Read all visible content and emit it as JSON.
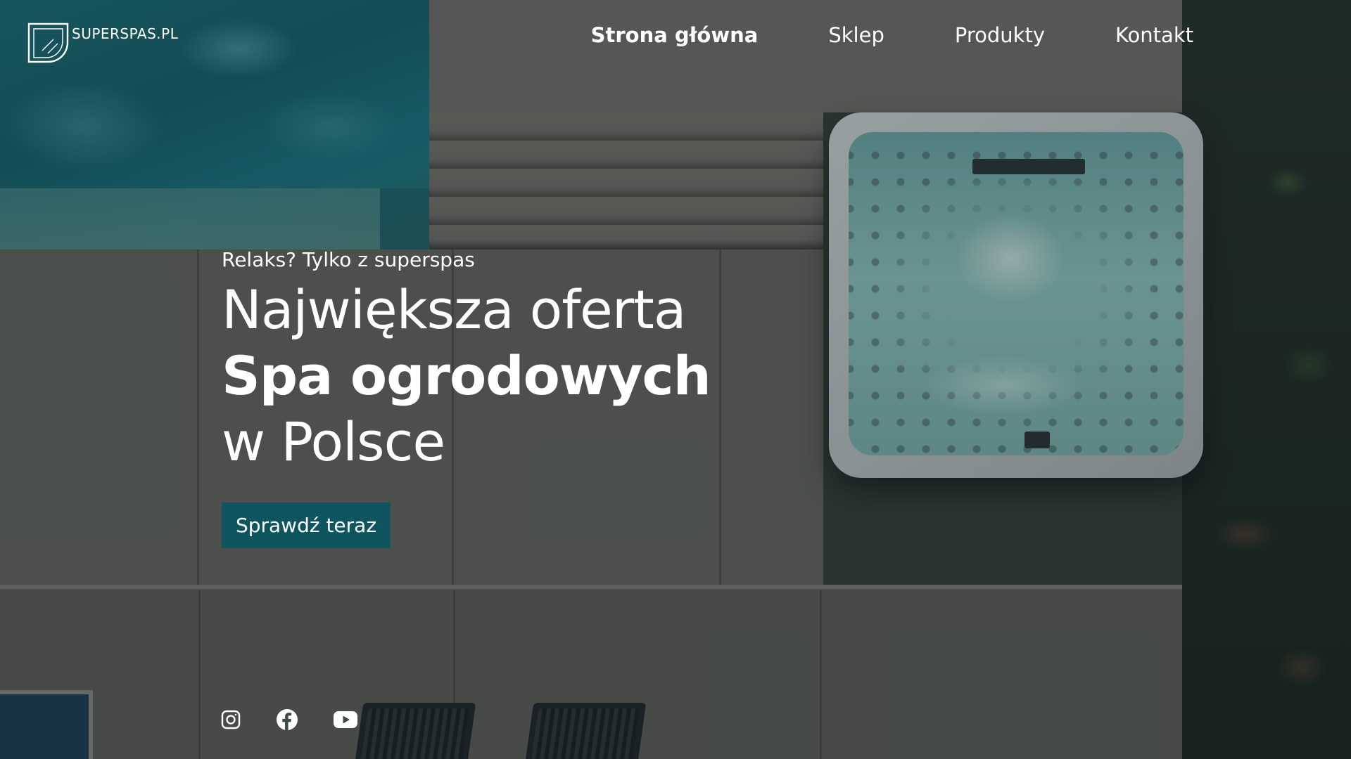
{
  "brand": {
    "logo_text": "SUPERSPAS.PL",
    "logo_icon": "spa-logo-icon"
  },
  "nav": {
    "items": [
      {
        "label": "Strona główna",
        "active": true
      },
      {
        "label": "Sklep",
        "active": false
      },
      {
        "label": "Produkty",
        "active": false
      },
      {
        "label": "Kontakt",
        "active": false
      }
    ]
  },
  "hero": {
    "eyebrow": "Relaks? Tylko z superspas",
    "headline_line1": "Największa oferta",
    "headline_line2": "Spa ogrodowych",
    "headline_line3": "w Polsce",
    "cta_label": "Sprawdź teraz"
  },
  "social": {
    "icons": [
      "instagram-icon",
      "facebook-icon",
      "youtube-icon"
    ]
  },
  "colors": {
    "cta_background": "#0e5560",
    "text": "#ffffff",
    "overlay": "#0a181c"
  }
}
